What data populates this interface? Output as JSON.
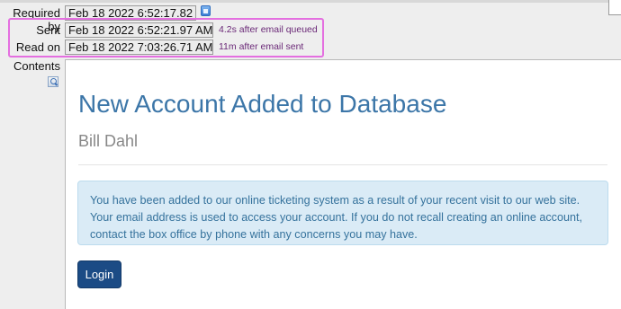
{
  "fields": {
    "required_by": {
      "label": "Required by",
      "value": "Feb 18 2022 6:52:17.82 AM"
    },
    "sent": {
      "label": "Sent",
      "value": "Feb 18 2022 6:52:21.97 AM",
      "note": "4.2s after email queued"
    },
    "read_on": {
      "label": "Read on",
      "value": "Feb 18 2022 7:03:26.71 AM",
      "note": "11m after email sent"
    },
    "contents": {
      "label": "Contents"
    }
  },
  "email": {
    "title": "New Account Added to Database",
    "subtitle": "Bill Dahl",
    "message": "You have been added to our online ticketing system as a result of your recent visit to our web site. Your email address is used to access your account. If you do not recall creating an online account, contact the box office by phone with any concerns you may have.",
    "button_label": "Login"
  },
  "colors": {
    "title": "#3c76a8",
    "highlight_border": "#e46fe0",
    "annotation_text": "#6a2877",
    "info_background": "#daebf6",
    "button_background": "#1b4b85"
  },
  "icons": {
    "calendar": "calendar-icon",
    "zoom": "zoom-icon"
  }
}
